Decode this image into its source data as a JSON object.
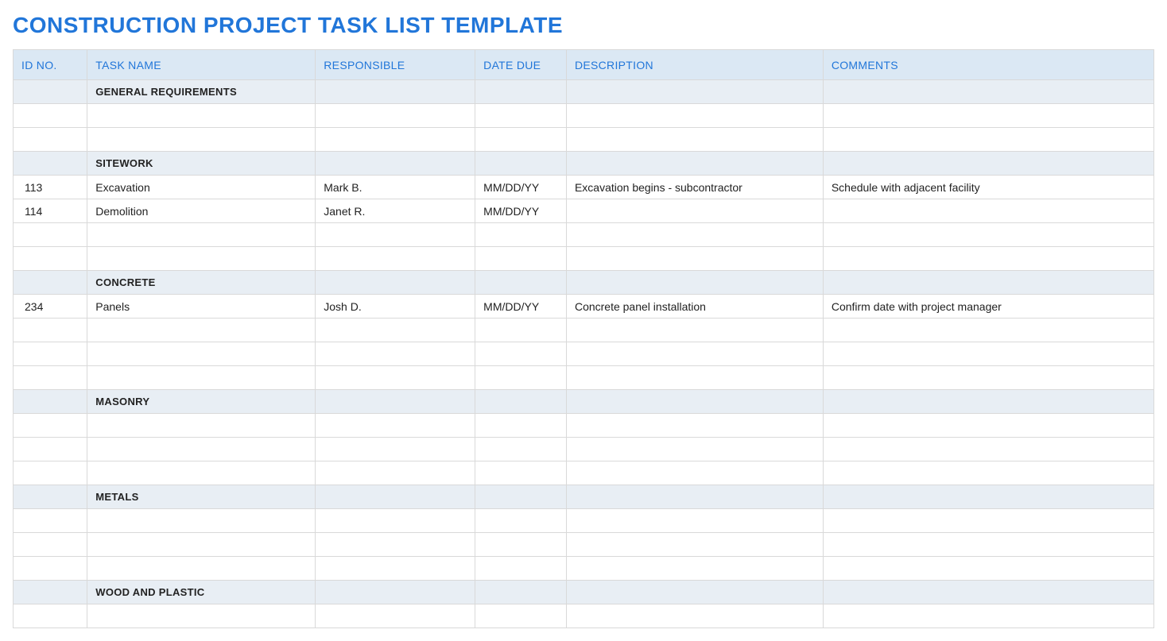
{
  "title": "CONSTRUCTION PROJECT TASK LIST TEMPLATE",
  "columns": {
    "id": "ID NO.",
    "task": "TASK NAME",
    "responsible": "RESPONSIBLE",
    "due": "DATE DUE",
    "description": "DESCRIPTION",
    "comments": "COMMENTS"
  },
  "rows": [
    {
      "type": "section",
      "label": "GENERAL REQUIREMENTS"
    },
    {
      "type": "blank"
    },
    {
      "type": "blank"
    },
    {
      "type": "section",
      "label": "SITEWORK"
    },
    {
      "type": "data",
      "id": "113",
      "task": "Excavation",
      "responsible": "Mark B.",
      "due": "MM/DD/YY",
      "description": "Excavation begins - subcontractor",
      "comments": "Schedule with adjacent facility"
    },
    {
      "type": "data",
      "id": "114",
      "task": "Demolition",
      "responsible": "Janet R.",
      "due": "MM/DD/YY",
      "description": "",
      "comments": ""
    },
    {
      "type": "blank"
    },
    {
      "type": "blank"
    },
    {
      "type": "section",
      "label": "CONCRETE"
    },
    {
      "type": "data",
      "id": "234",
      "task": "Panels",
      "responsible": "Josh D.",
      "due": "MM/DD/YY",
      "description": "Concrete panel installation",
      "comments": "Confirm date with project manager"
    },
    {
      "type": "blank"
    },
    {
      "type": "blank"
    },
    {
      "type": "blank"
    },
    {
      "type": "section",
      "label": "MASONRY"
    },
    {
      "type": "blank"
    },
    {
      "type": "blank"
    },
    {
      "type": "blank"
    },
    {
      "type": "section",
      "label": "METALS"
    },
    {
      "type": "blank"
    },
    {
      "type": "blank"
    },
    {
      "type": "blank"
    },
    {
      "type": "section",
      "label": "WOOD AND PLASTIC"
    },
    {
      "type": "blank"
    }
  ]
}
